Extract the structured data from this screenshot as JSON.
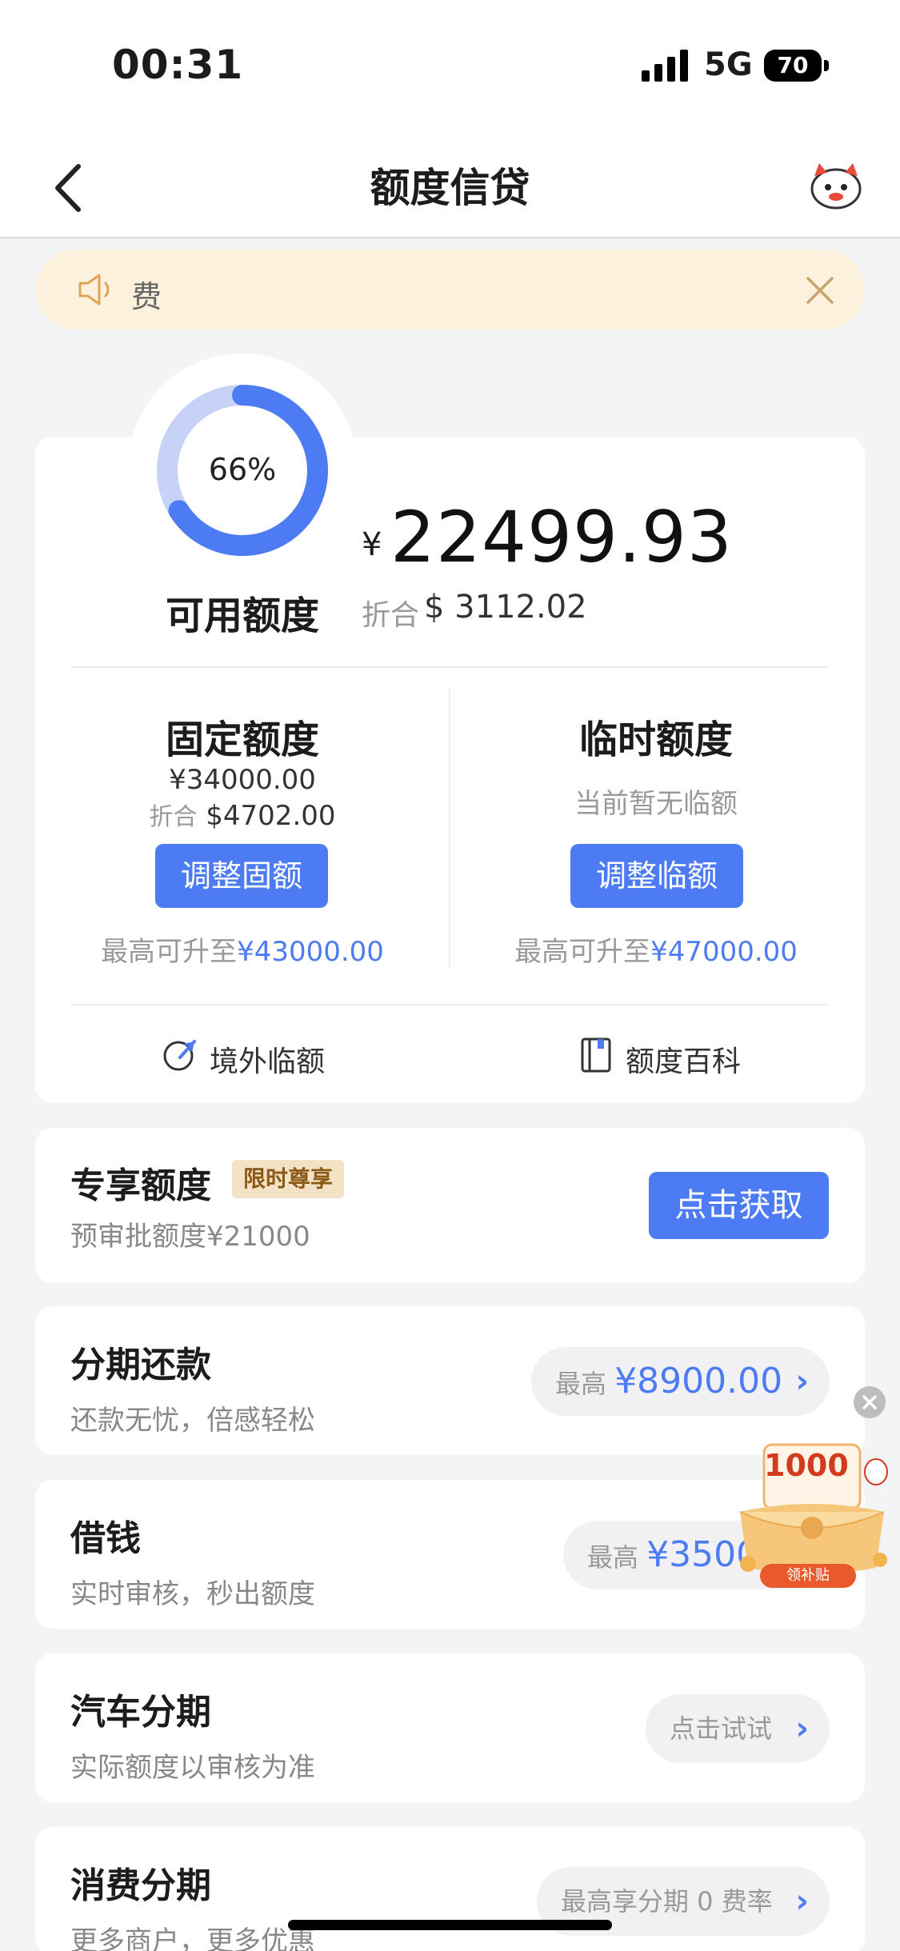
{
  "status_bar": {
    "time": "00:31",
    "network": "5G",
    "battery": "70"
  },
  "nav": {
    "title": "额度信贷",
    "back_icon": "chevron-left-icon",
    "mascot_icon": "mascot-icon"
  },
  "notice": {
    "text": "费",
    "speaker_icon": "speaker-icon",
    "close_icon": "close-icon"
  },
  "credit": {
    "usage_percent_label": "66%",
    "usage_fraction": 0.66,
    "available_label": "可用额度",
    "currency_symbol": "¥",
    "available_amount": "22499.93",
    "conv_label": "折合",
    "conv_value": "$ 3112.02",
    "fixed": {
      "title": "固定额度",
      "amount": "¥34000.00",
      "conv_label": "折合",
      "conv_value": "$4702.00",
      "button": "调整固额",
      "max_label": "最高可升至",
      "max_value": "¥43000.00"
    },
    "temporary": {
      "title": "临时额度",
      "none_text": "当前暂无临额",
      "button": "调整临额",
      "max_label": "最高可升至",
      "max_value": "¥47000.00"
    },
    "footer": {
      "overseas_label": "境外临额",
      "wiki_label": "额度百科"
    }
  },
  "exclusive": {
    "title": "专享额度",
    "badge": "限时尊享",
    "subtitle": "预审批额度¥21000",
    "button": "点击获取"
  },
  "rows": [
    {
      "title": "分期还款",
      "subtitle": "还款无忧，倍感轻松",
      "pill_label": "最高",
      "pill_value": "¥8900.00"
    },
    {
      "title": "借钱",
      "subtitle": "实时审核，秒出额度",
      "pill_label": "最高",
      "pill_value": "¥3500"
    },
    {
      "title": "汽车分期",
      "subtitle": "实际额度以审核为准",
      "pill_label": "点击试试",
      "pill_value": ""
    },
    {
      "title": "消费分期",
      "subtitle": "更多商户，更多优惠",
      "pill_label": "最高享分期 0 费率",
      "pill_value": ""
    }
  ],
  "promo": {
    "amount": "1000",
    "tag": "领补贴"
  },
  "colors": {
    "accent": "#4d7bf3",
    "notice_bg": "#fbf1dc",
    "page_bg": "#f3f4f6"
  }
}
